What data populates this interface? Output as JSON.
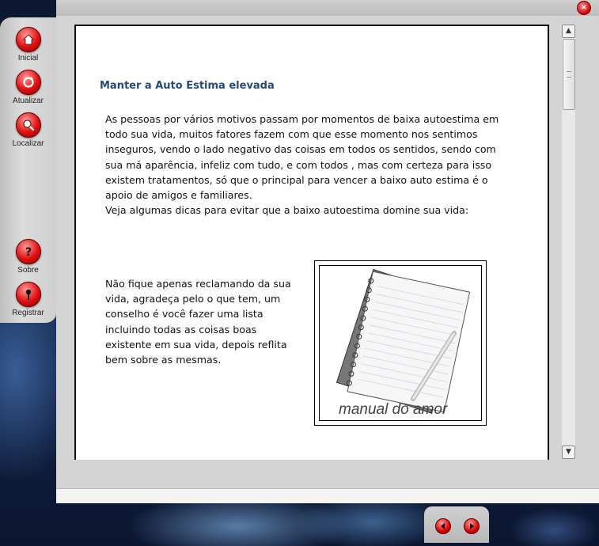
{
  "sidebar": {
    "items": [
      {
        "label": "Inicial",
        "icon": "home-icon"
      },
      {
        "label": "Atualizar",
        "icon": "refresh-icon"
      },
      {
        "label": "Localizar",
        "icon": "search-icon"
      },
      {
        "label": "Sobre",
        "icon": "question-icon"
      },
      {
        "label": "Registrar",
        "icon": "pin-icon"
      }
    ]
  },
  "window": {
    "close_label": "×"
  },
  "content": {
    "title": "Manter a Auto Estima elevada",
    "intro": "As pessoas por vários motivos passam por momentos de baixa autoestima em todo sua vida, muitos fatores fazem com que esse momento nos sentimos inseguros, vendo o lado negativo das coisas em todos os sentidos, sendo com sua má aparência, infeliz com tudo, e com todos , mas com certeza para isso existem tratamentos, só que o principal para vencer a baixo auto estima é o apoio de amigos e familiares.",
    "intro2": "Veja algumas dicas para evitar que a baixo autoestima domine sua vida:",
    "tip": "Não fique apenas reclamando da sua vida, agradeça pelo o que tem, um conselho é você fazer uma lista incluindo todas as coisas boas existente em sua vida, depois reflita bem sobre as mesmas.",
    "image_caption": "manual do amor"
  },
  "scrollbar": {
    "up": "▲",
    "down": "▼"
  },
  "colors": {
    "accent_red": "#e01010",
    "title_blue": "#244b78"
  }
}
